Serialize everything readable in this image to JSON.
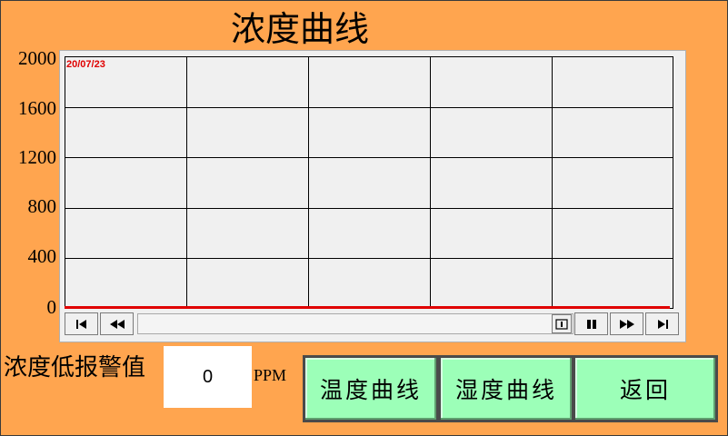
{
  "title": "浓度曲线",
  "chart": {
    "date_label": "20/07/23",
    "y_ticks": [
      "2000",
      "1600",
      "1200",
      "800",
      "400",
      "0"
    ],
    "line_color": "#E00000"
  },
  "chart_data": {
    "type": "line",
    "title": "",
    "xlabel": "",
    "ylabel": "",
    "ylim": [
      0,
      2000
    ],
    "y_ticks": [
      0,
      400,
      800,
      1200,
      1600,
      2000
    ],
    "grid": true,
    "series": [
      {
        "values": [
          0,
          0,
          0,
          0,
          0,
          0
        ]
      }
    ]
  },
  "toolbar": {
    "buttons": [
      "first-icon",
      "rewind-icon",
      "zoom-icon",
      "pause-icon",
      "fast-forward-icon",
      "last-icon"
    ]
  },
  "alarm": {
    "label": "浓度低报警值",
    "value": "0",
    "unit": "PPM"
  },
  "nav": {
    "temperature": "温度曲线",
    "humidity": "湿度曲线",
    "back": "返回"
  },
  "colors": {
    "background": "#FFA54F",
    "button": "#9CFFB8",
    "plot": "#F0F0F0"
  }
}
